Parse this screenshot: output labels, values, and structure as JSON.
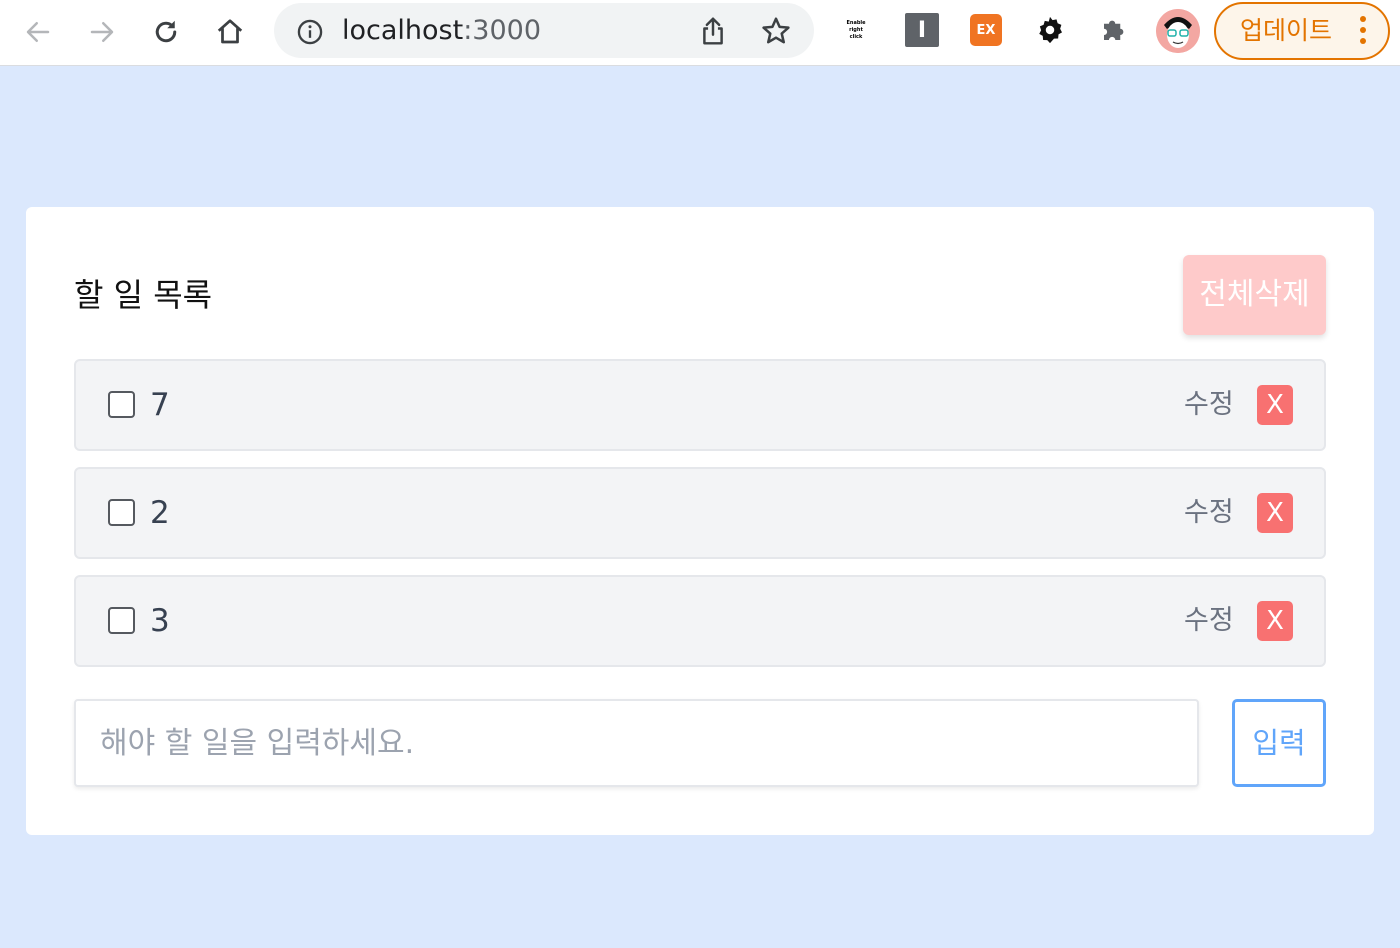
{
  "browser": {
    "url_host": "localhost",
    "url_port": ":3000",
    "extensions": {
      "right_click_line1": "Enable",
      "right_click_line2": "right",
      "right_click_line3": "click",
      "i_ext_label": "I",
      "ex_ext_label": "EX"
    },
    "update_label": "업데이트",
    "icons": [
      "back-arrow-icon",
      "forward-arrow-icon",
      "reload-icon",
      "home-icon",
      "info-icon",
      "share-icon",
      "star-icon",
      "gear-icon",
      "puzzle-icon",
      "kebab-menu-icon"
    ],
    "colors": {
      "update_accent": "#e37400",
      "page_background": "#dbe8fd"
    }
  },
  "todo": {
    "title": "할 일 목록",
    "delete_all_label": "전체삭제",
    "items": [
      {
        "text": "7",
        "checked": false,
        "edit_label": "수정",
        "delete_label": "X"
      },
      {
        "text": "2",
        "checked": false,
        "edit_label": "수정",
        "delete_label": "X"
      },
      {
        "text": "3",
        "checked": false,
        "edit_label": "수정",
        "delete_label": "X"
      }
    ],
    "input_placeholder": "해야 할 일을 입력하세요.",
    "submit_label": "입력",
    "colors": {
      "delete_all_bg": "#fecaca",
      "delete_item_bg": "#f87171",
      "submit_border": "#60a5fa",
      "row_bg": "#f3f4f6"
    }
  }
}
